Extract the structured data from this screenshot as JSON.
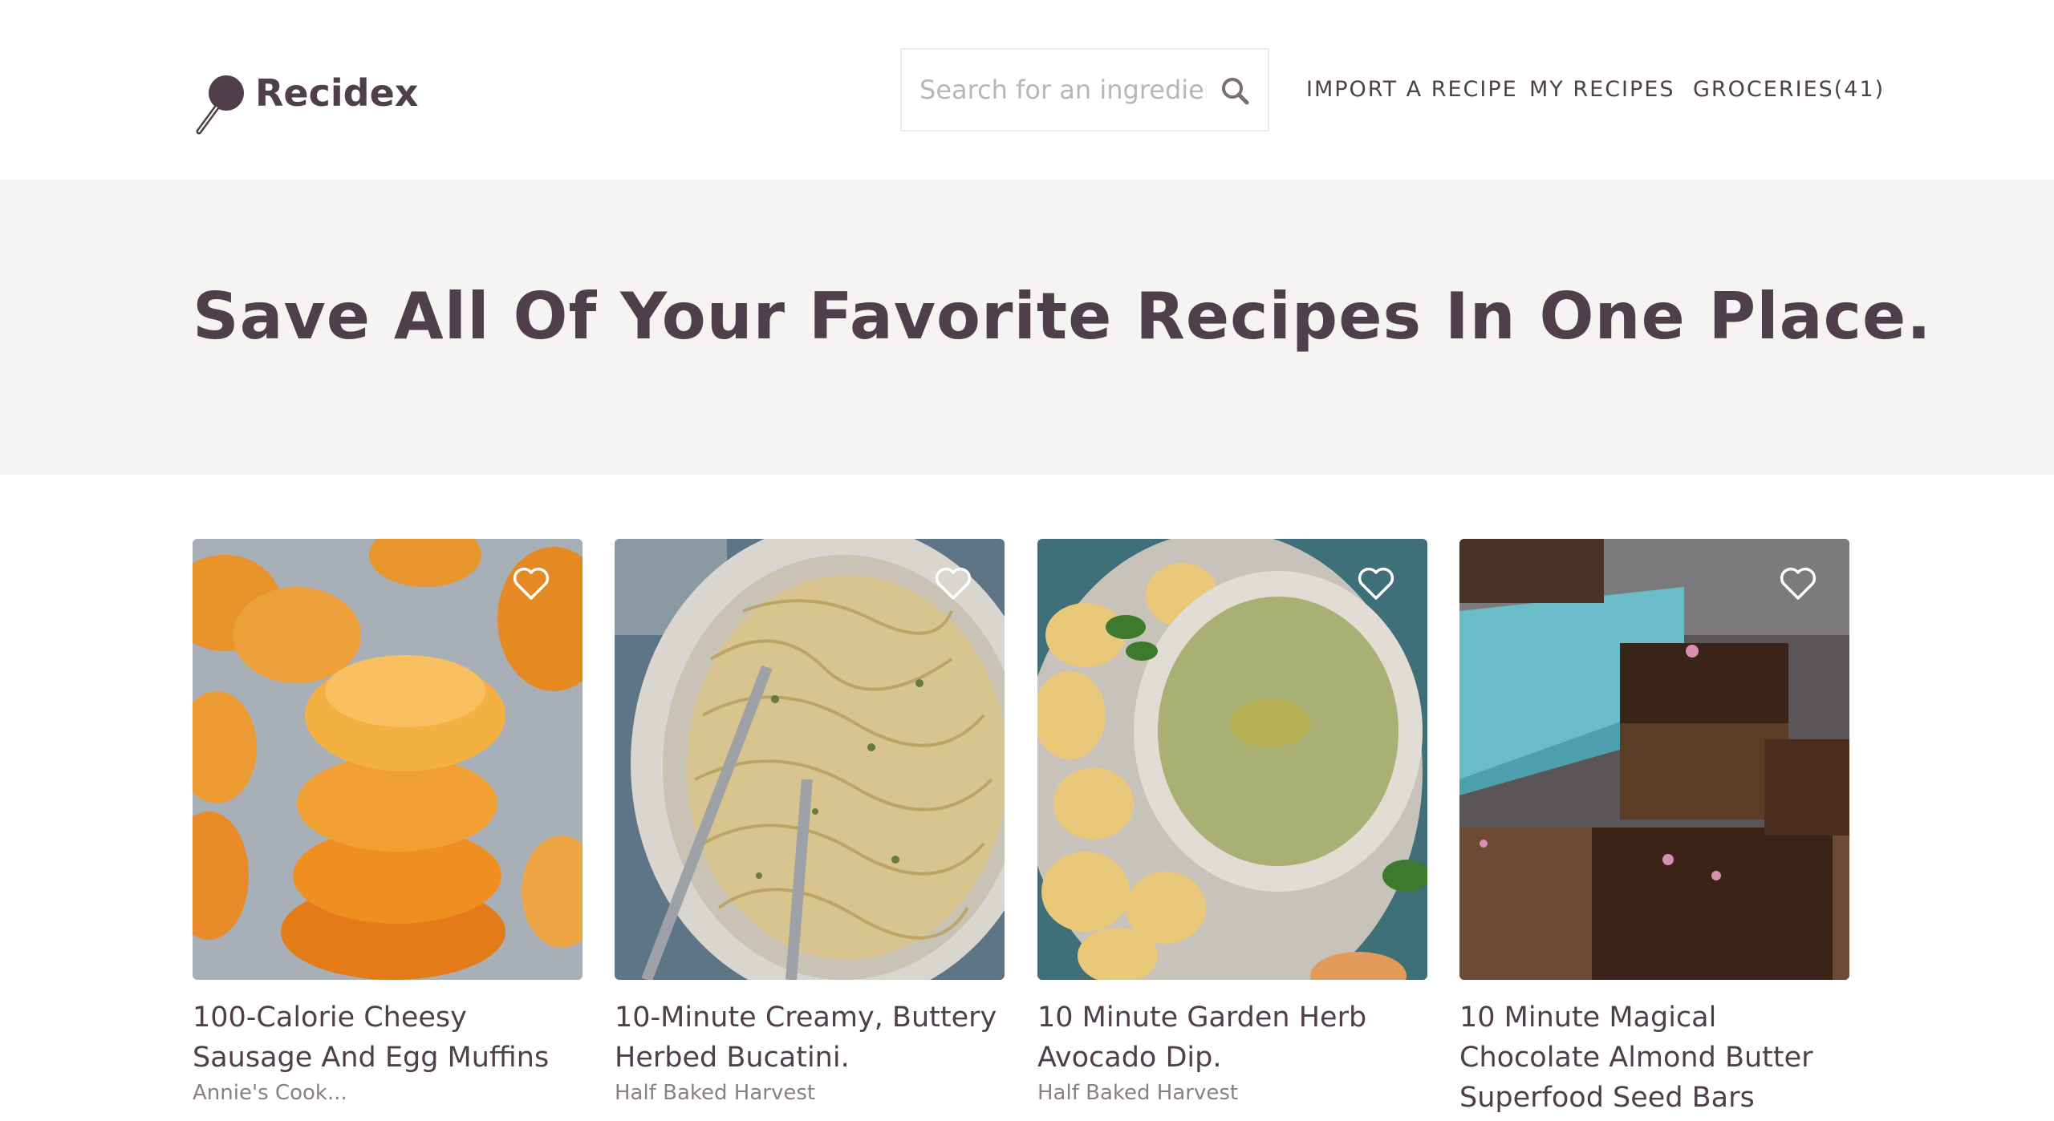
{
  "brand": {
    "name": "Recidex",
    "logo_icon": "frying-pan-icon"
  },
  "search": {
    "placeholder": "Search for an ingredient",
    "value": "",
    "icon": "search-icon"
  },
  "nav": {
    "import_label": "IMPORT A RECIPE",
    "my_recipes_label": "MY RECIPES",
    "groceries_label": "GROCERIES(41)"
  },
  "hero": {
    "title": "Save All Of Your Favorite Recipes In One Place."
  },
  "recipes": [
    {
      "title": "100-Calorie Cheesy Sausage And Egg Muffins",
      "source": "Annie's Cook...",
      "favorite_icon": "heart-icon"
    },
    {
      "title": "10-Minute Creamy, Buttery Herbed Bucatini.",
      "source": "Half Baked Harvest",
      "favorite_icon": "heart-icon"
    },
    {
      "title": "10 Minute Garden Herb Avocado Dip.",
      "source": "Half Baked Harvest",
      "favorite_icon": "heart-icon"
    },
    {
      "title": "10 Minute Magical Chocolate Almond Butter Superfood Seed Bars",
      "source": "",
      "favorite_icon": "heart-icon"
    }
  ],
  "colors": {
    "brand": "#4f3f4b",
    "hero_bg": "#f5f4f2",
    "border": "#ececec"
  }
}
